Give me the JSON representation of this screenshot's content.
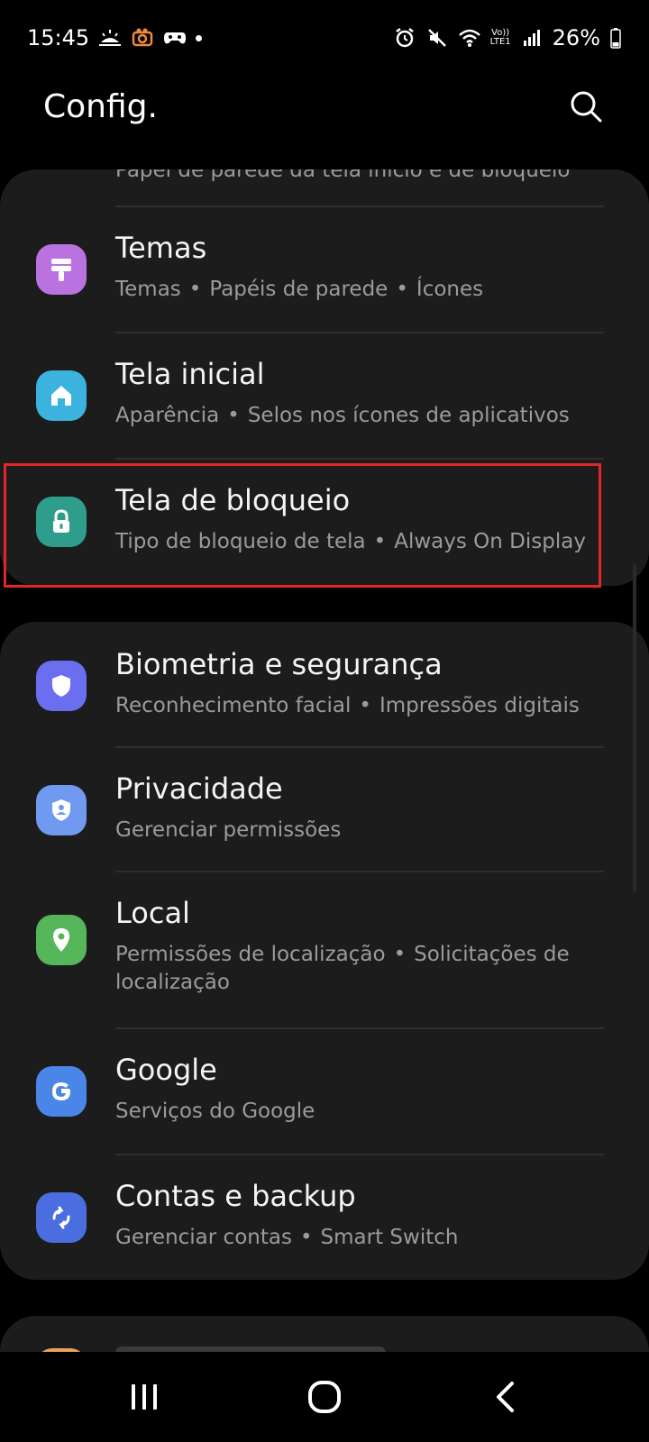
{
  "status_bar": {
    "time": "15:45",
    "battery": "26%",
    "network_label": "LTE1",
    "volte_label": "Vo))"
  },
  "header": {
    "title": "Config."
  },
  "top_card": {
    "peek_subtitle": "Papel de parede da tela início e de bloqueio",
    "items": [
      {
        "title": "Temas",
        "subs": [
          "Temas",
          "Papéis de parede",
          "Ícones"
        ],
        "icon": "paint-roller-icon",
        "color": "#b972e0"
      },
      {
        "title": "Tela inicial",
        "subs": [
          "Aparência",
          "Selos nos ícones de aplicativos"
        ],
        "icon": "home-icon",
        "color": "#3cb3df"
      },
      {
        "title": "Tela de bloqueio",
        "subs": [
          "Tipo de bloqueio de tela",
          "Always On Display"
        ],
        "icon": "lock-icon",
        "color": "#2e9d8c"
      }
    ]
  },
  "second_card": {
    "items": [
      {
        "title": "Biometria e segurança",
        "subs": [
          "Reconhecimento facial",
          "Impressões digitais"
        ],
        "icon": "shield-icon",
        "color": "#6c6ef0"
      },
      {
        "title": "Privacidade",
        "subs": [
          "Gerenciar permissões"
        ],
        "icon": "privacy-shield-icon",
        "color": "#6f9af0"
      },
      {
        "title": "Local",
        "subs": [
          "Permissões de localização",
          "Solicitações de localização"
        ],
        "icon": "location-pin-icon",
        "color": "#55b65a"
      },
      {
        "title": "Google",
        "subs": [
          "Serviços do Google"
        ],
        "icon": "google-icon",
        "color": "#4a86e8"
      },
      {
        "title": "Contas e backup",
        "subs": [
          "Gerenciar contas",
          "Smart Switch"
        ],
        "icon": "sync-icon",
        "color": "#4a6ee0"
      }
    ]
  },
  "bottom_peek": {
    "icon": "partial-icon",
    "color": "#e9a25a"
  },
  "highlight_color": "#e0262b"
}
